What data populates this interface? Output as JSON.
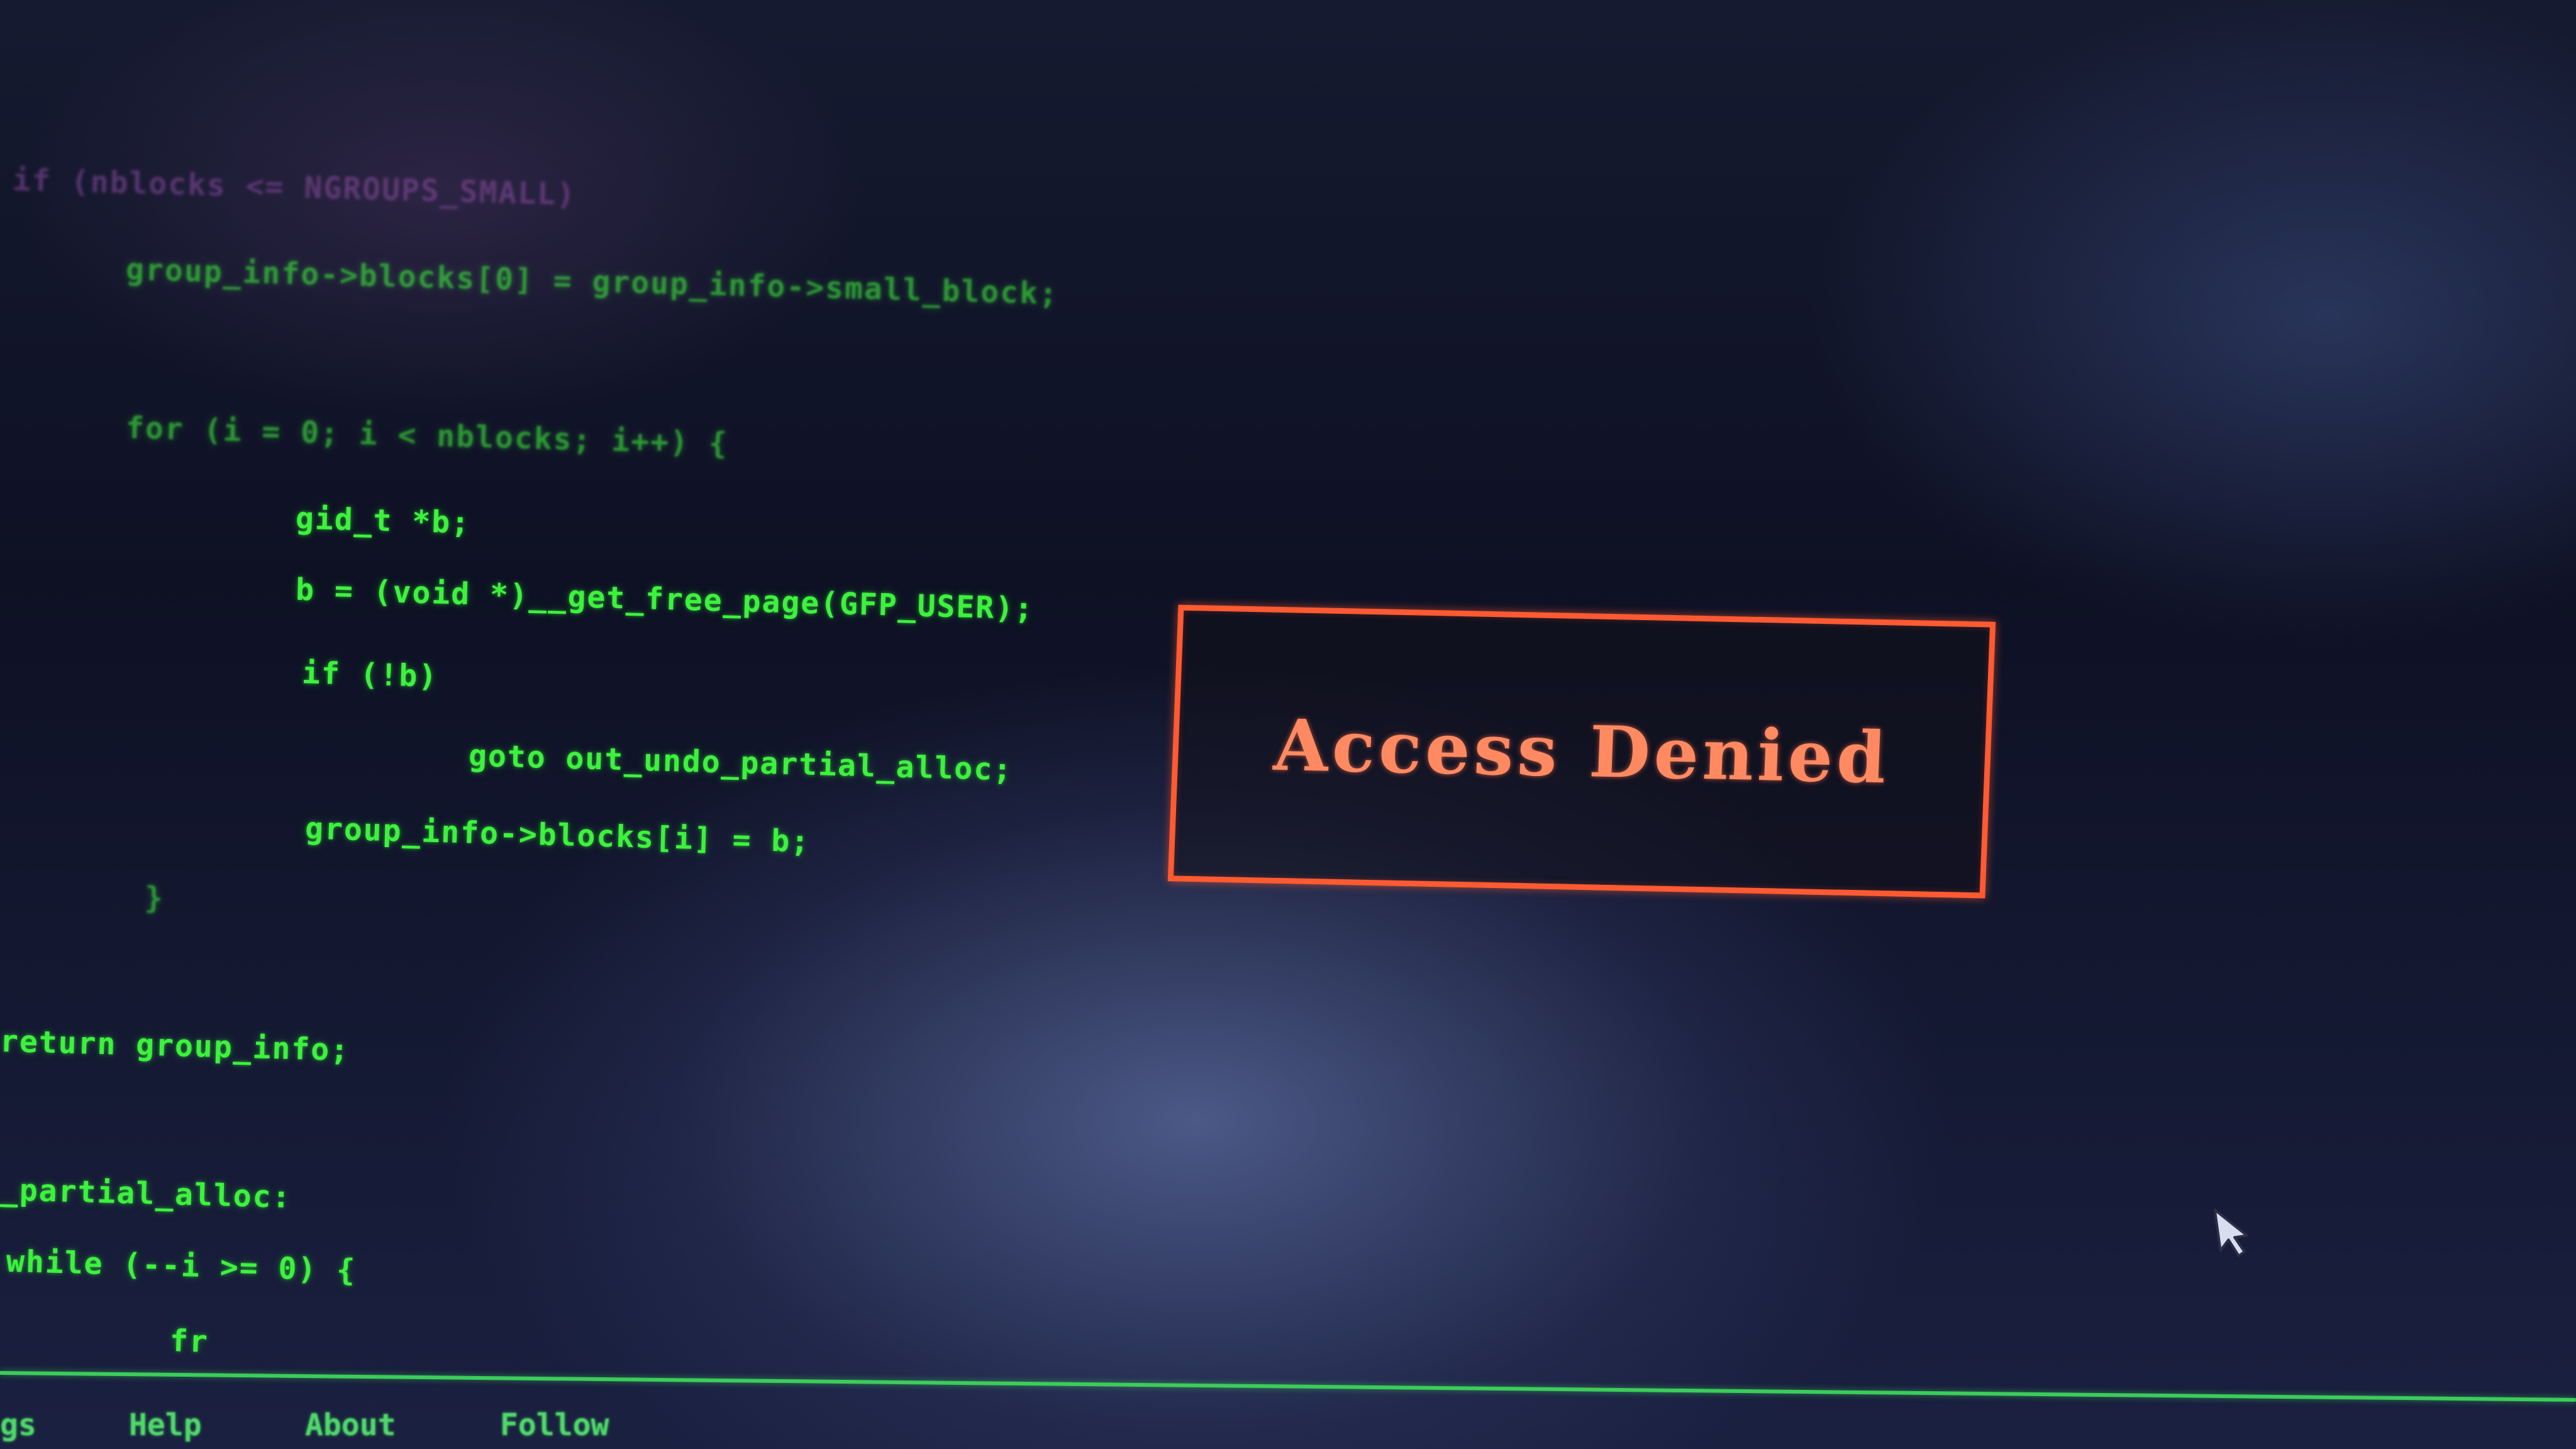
{
  "terminal": {
    "lines": [
      "if (nblocks <= NGROUPS_SMALL)",
      "group_info->blocks[0] = group_info->small_block;",
      "for (i = 0; i < nblocks; i++) {",
      "gid_t *b;",
      "b = (void *)__get_free_page(GFP_USER);",
      "if (!b)",
      "goto out_undo_partial_alloc;",
      "group_info->blocks[i] = b;",
      "}",
      "return group_info;",
      "_partial_alloc:",
      "while (--i >= 0) {",
      "fr"
    ]
  },
  "dialog": {
    "message": "Access Denied",
    "border_color": "#ff5a32",
    "text_color": "#ff8a62"
  },
  "menu": {
    "items": [
      "gs",
      "Help",
      "About",
      "Follow"
    ]
  },
  "cursor": {
    "icon": "mouse-pointer-icon"
  },
  "colors": {
    "code_green": "#3df23d",
    "background": "#0b0d1a",
    "status_rule": "#3ccc5a"
  }
}
